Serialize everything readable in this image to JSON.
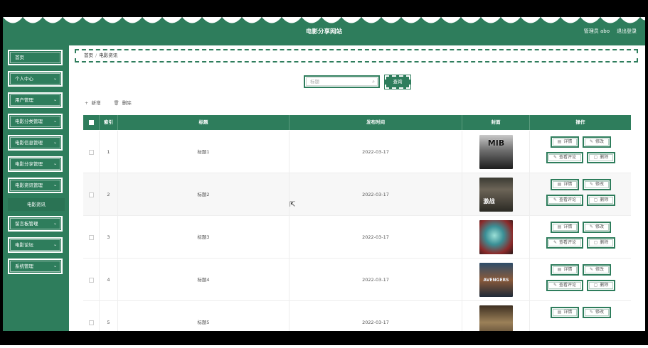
{
  "app": {
    "title": "电影分享网站"
  },
  "header": {
    "user": "管理员 abo",
    "logout": "退出登录"
  },
  "colors": {
    "primary": "#2e7d5c",
    "background": "#ffffff"
  },
  "sidebar": {
    "items": [
      {
        "label": "首页",
        "chevron": ""
      },
      {
        "label": "个人中心",
        "chevron": "⌄"
      },
      {
        "label": "用户管理",
        "chevron": "⌄"
      },
      {
        "label": "电影分类管理",
        "chevron": "⌄"
      },
      {
        "label": "电影信息管理",
        "chevron": "⌄"
      },
      {
        "label": "电影分享管理",
        "chevron": "⌄"
      },
      {
        "label": "电影资讯管理",
        "chevron": "⌄"
      },
      {
        "label": "留言板管理",
        "chevron": "⌄"
      },
      {
        "label": "电影论坛",
        "chevron": "⌄"
      },
      {
        "label": "系统管理",
        "chevron": "⌄"
      }
    ],
    "sub_item": "电影资讯"
  },
  "breadcrumb": {
    "home": "首页",
    "separator": "/",
    "current": "电影资讯"
  },
  "search": {
    "placeholder": "标题",
    "button": "查询"
  },
  "toolbar": {
    "add": "新增",
    "delete": "删除"
  },
  "table": {
    "columns": {
      "index": "索引",
      "title": "标题",
      "time": "发布时间",
      "cover": "封面",
      "actions": "操作"
    },
    "rows": [
      {
        "index": "1",
        "title": "标题1",
        "time": "2022-03-17",
        "cover_text": "MIB"
      },
      {
        "index": "2",
        "title": "标题2",
        "time": "2022-03-17",
        "cover_text": "激战"
      },
      {
        "index": "3",
        "title": "标题3",
        "time": "2022-03-17",
        "cover_text": ""
      },
      {
        "index": "4",
        "title": "标题4",
        "time": "2022-03-17",
        "cover_text": "AVENGERS"
      },
      {
        "index": "5",
        "title": "标题5",
        "time": "2022-03-17",
        "cover_text": ""
      }
    ],
    "actions": {
      "detail": "详情",
      "edit": "修改",
      "comments": "查看评论",
      "delete": "删除"
    }
  }
}
